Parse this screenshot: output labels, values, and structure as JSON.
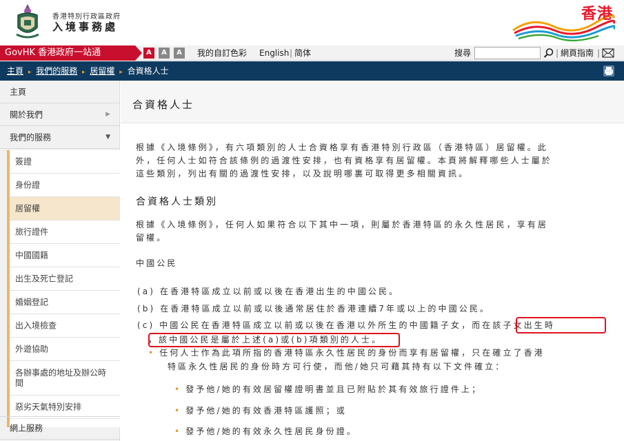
{
  "header": {
    "dept_small": "香港特別行政區政府",
    "dept_big": "入境事務處",
    "brand": "香港"
  },
  "topbar": {
    "govhk": "GovHK 香港政府一站通",
    "font_sizes": [
      "A",
      "A",
      "A"
    ],
    "custom_color": "我的自訂色彩",
    "english": "English",
    "simplified": "简体",
    "search_label": "搜尋",
    "search_value": "",
    "guide": "網頁指南"
  },
  "breadcrumb": {
    "home": "主頁",
    "services": "我們的服務",
    "abode": "居留權",
    "current": "合資格人士"
  },
  "sidebar": {
    "top_items": [
      {
        "label": "主頁"
      },
      {
        "label": "關於我們",
        "arrow": "▶"
      },
      {
        "label": "我們的服務",
        "arrow": "▼"
      }
    ],
    "sub_items": [
      {
        "label": "簽證"
      },
      {
        "label": "身份證"
      },
      {
        "label": "居留權"
      },
      {
        "label": "旅行證件"
      },
      {
        "label": "中國國籍"
      },
      {
        "label": "出生及死亡登記"
      },
      {
        "label": "婚姻登記"
      },
      {
        "label": "出入境檢查"
      },
      {
        "label": "外遊協助"
      },
      {
        "label": "各辦事處的地址及辦公時間"
      },
      {
        "label": "惡劣天氣特別安排"
      }
    ],
    "bottom_item": "網上服務"
  },
  "main": {
    "title": "合資格人士",
    "intro_lines": [
      "根據《入境條例》，有六項類別的人士合資格享有香港特別行政區（香港特區）居留權。此",
      "外，任何人士如符合該條例的過渡性安排，也有資格享有居留權。本頁將解釋哪些人士屬於",
      "這些類別，列出有關的過渡性安排，以及說明哪裏可取得更多相關資訊。"
    ],
    "section_title": "合資格人士類別",
    "section_lines": [
      "根據《入境條例》，任何人如果符合以下其中一項，則屬於香港特區的永久性居民，享有居",
      "留權。"
    ],
    "sub_title": "中國公民",
    "item_a": "(a) 在香港特區成立以前或以後在香港出生的中國公民。",
    "item_b": "(b) 在香港特區成立以前或以後通常居住於香港連續7年或以上的中國公民。",
    "item_c_1": "(c) 中國公民在香港特區成立以前或以後在香港以外所生的中國籍子女，而在該子女出生時",
    "item_c_2": "，該中國公民是屬於上述(a)或(b)項類別的人士。",
    "note_lines": [
      "任何人士作為此項所指的香港特區永久性居民的身份而享有居留權，只在確立了香港",
      "特區永久性居民的身份時方可行使，而他/她只可藉其持有以下文件確立："
    ],
    "docs": [
      "發予他/她的有效居留權證明書並且已附貼於其有效旅行證件上；",
      "發予他/她的有效香港特區護照；或",
      "發予他/她的有效永久性居民身份證。"
    ]
  }
}
